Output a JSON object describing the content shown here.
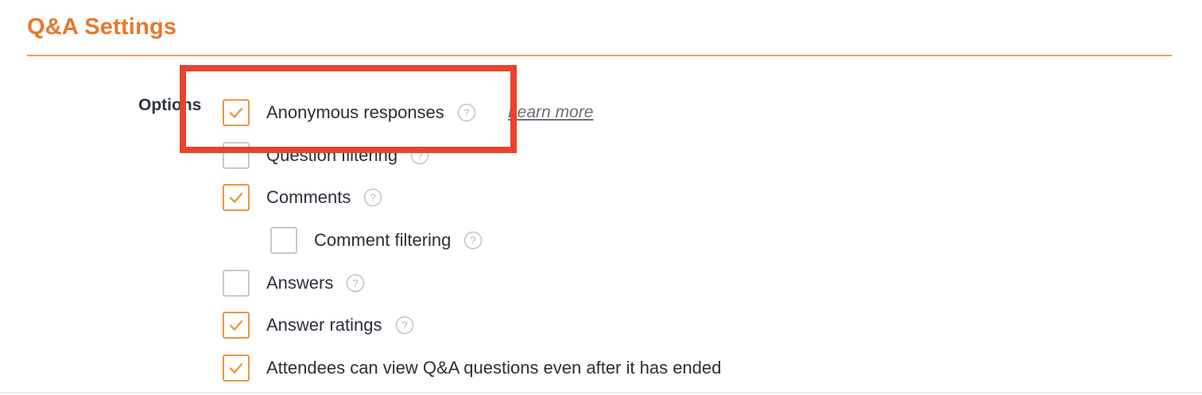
{
  "section": {
    "title": "Q&A Settings"
  },
  "options": {
    "label": "Options",
    "learn_more": "Learn more",
    "accent_color": "#eb9840",
    "highlight_color": "#e8432b",
    "items": [
      {
        "label": "Anonymous responses",
        "checked": true,
        "help": true
      },
      {
        "label": "Question filtering",
        "checked": false,
        "help": true
      },
      {
        "label": "Comments",
        "checked": true,
        "help": true
      },
      {
        "label": "Comment filtering",
        "checked": false,
        "help": true
      },
      {
        "label": "Answers",
        "checked": false,
        "help": true
      },
      {
        "label": "Answer ratings",
        "checked": true,
        "help": true
      },
      {
        "label": "Attendees can view Q&A questions even after it has ended",
        "checked": true,
        "help": false
      }
    ]
  }
}
